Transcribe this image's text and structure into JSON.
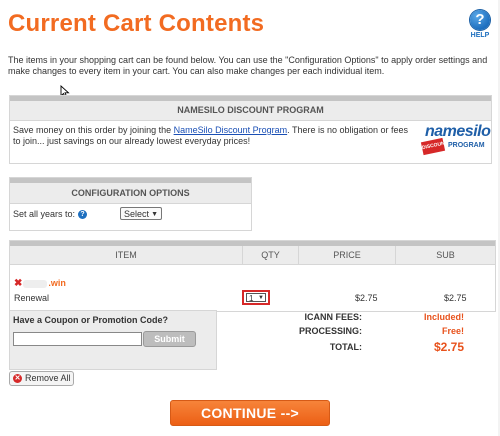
{
  "page": {
    "title": "Current Cart Contents",
    "help_label": "HELP",
    "help_glyph": "?"
  },
  "intro": "The items in your shopping cart can be found below. You can use the \"Configuration Options\" to apply order settings and make changes to every item in your cart. You can also make changes per each individual item.",
  "discount": {
    "heading": "NAMESILO DISCOUNT PROGRAM",
    "text_before": "Save money on this order by joining the ",
    "link": "NameSilo Discount Program",
    "text_after": ". There is no obligation or fees to join... just savings on our already lowest everyday prices!",
    "logo_word": "namesilo",
    "logo_ribbon": "DISCOUNT",
    "logo_program": "PROGRAM"
  },
  "config": {
    "heading": "CONFIGURATION OPTIONS",
    "years_label": "Set all years to:",
    "years_select": "Select"
  },
  "cart": {
    "columns": [
      "ITEM",
      "QTY",
      "PRICE",
      "SUB"
    ],
    "item": {
      "domain_suffix": ".win",
      "type": "Renewal",
      "qty": "1",
      "price": "$2.75",
      "sub": "$2.75"
    }
  },
  "coupon": {
    "title": "Have a Coupon or Promotion Code?",
    "value": "",
    "button": "Submit"
  },
  "totals": [
    {
      "label": "ICANN FEES:",
      "value": "Included!"
    },
    {
      "label": "PROCESSING:",
      "value": "Free!"
    },
    {
      "label": "TOTAL:",
      "value": "$2.75"
    }
  ],
  "remove_all": "Remove All",
  "continue": "CONTINUE -->",
  "colors": {
    "accent": "#f26b21",
    "help_blue": "#1e6fbf",
    "alert_red": "#d62828",
    "header_gray": "#ececec"
  }
}
